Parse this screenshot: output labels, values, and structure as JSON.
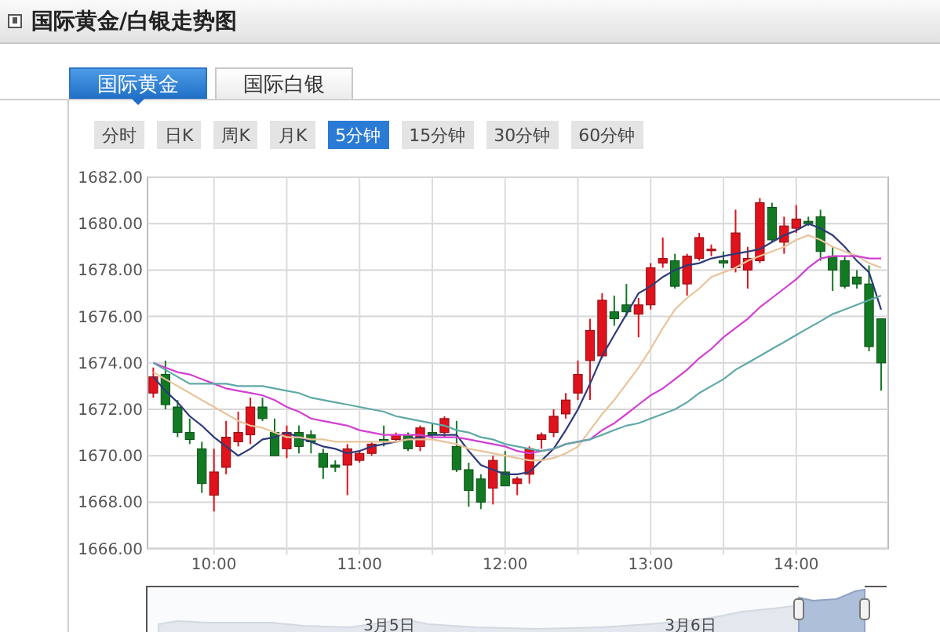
{
  "header": {
    "title": "国际黄金/白银走势图"
  },
  "tabs": [
    {
      "label": "国际黄金",
      "selected": true
    },
    {
      "label": "国际白银",
      "selected": false
    }
  ],
  "periods": [
    {
      "label": "分时",
      "selected": false
    },
    {
      "label": "日K",
      "selected": false
    },
    {
      "label": "周K",
      "selected": false
    },
    {
      "label": "月K",
      "selected": false
    },
    {
      "label": "5分钟",
      "selected": true
    },
    {
      "label": "15分钟",
      "selected": false
    },
    {
      "label": "30分钟",
      "selected": false
    },
    {
      "label": "60分钟",
      "selected": false
    }
  ],
  "chart": {
    "chart_data": {
      "type": "candlestick",
      "grid": true,
      "ylim": [
        1666,
        1682
      ],
      "yticks": [
        {
          "value": 1666,
          "label": "1666.00"
        },
        {
          "value": 1668,
          "label": "1668.00"
        },
        {
          "value": 1670,
          "label": "1670.00"
        },
        {
          "value": 1672,
          "label": "1672.00"
        },
        {
          "value": 1674,
          "label": "1674.00"
        },
        {
          "value": 1676,
          "label": "1676.00"
        },
        {
          "value": 1678,
          "label": "1678.00"
        },
        {
          "value": 1680,
          "label": "1680.00"
        },
        {
          "value": 1682,
          "label": "1682.00"
        }
      ],
      "categories": [
        null,
        null,
        null,
        null,
        null,
        "10:00",
        null,
        null,
        null,
        null,
        null,
        null,
        null,
        null,
        null,
        null,
        null,
        "11:00",
        null,
        null,
        null,
        null,
        null,
        null,
        null,
        null,
        null,
        null,
        null,
        "12:00",
        null,
        null,
        null,
        null,
        null,
        null,
        null,
        null,
        null,
        null,
        null,
        "13:00",
        null,
        null,
        null,
        null,
        null,
        null,
        null,
        null,
        null,
        null,
        null,
        "14:00",
        null,
        null,
        null,
        null,
        null,
        null,
        null
      ],
      "ohlc": [
        [
          1672.7,
          1673.8,
          1672.5,
          1673.4
        ],
        [
          1673.5,
          1674.1,
          1672.0,
          1672.2
        ],
        [
          1672.1,
          1672.4,
          1670.8,
          1671.0
        ],
        [
          1671.0,
          1671.6,
          1670.5,
          1670.7
        ],
        [
          1670.3,
          1670.6,
          1668.4,
          1668.8
        ],
        [
          1668.3,
          1670.3,
          1667.6,
          1669.3
        ],
        [
          1669.5,
          1671.5,
          1669.2,
          1670.8
        ],
        [
          1670.6,
          1671.9,
          1670.4,
          1671.0
        ],
        [
          1670.9,
          1672.5,
          1670.5,
          1672.1
        ],
        [
          1672.1,
          1672.5,
          1671.5,
          1671.6
        ],
        [
          1671.0,
          1671.6,
          1670.0,
          1670.0
        ],
        [
          1670.3,
          1671.3,
          1669.9,
          1671.0
        ],
        [
          1671.0,
          1671.3,
          1670.1,
          1670.4
        ],
        [
          1670.9,
          1671.1,
          1670.1,
          1670.6
        ],
        [
          1670.1,
          1670.3,
          1669.0,
          1669.5
        ],
        [
          1669.6,
          1669.8,
          1669.3,
          1669.5
        ],
        [
          1669.6,
          1670.5,
          1668.3,
          1670.3
        ],
        [
          1669.8,
          1670.2,
          1669.7,
          1670.1
        ],
        [
          1670.1,
          1670.6,
          1670.0,
          1670.5
        ],
        [
          1670.7,
          1671.3,
          1670.4,
          1670.6
        ],
        [
          1670.7,
          1671.0,
          1670.6,
          1670.9
        ],
        [
          1670.9,
          1671.0,
          1670.2,
          1670.3
        ],
        [
          1670.4,
          1671.3,
          1670.2,
          1671.2
        ],
        [
          1671.0,
          1671.4,
          1670.7,
          1670.9
        ],
        [
          1671.0,
          1671.7,
          1670.8,
          1671.6
        ],
        [
          1670.4,
          1671.5,
          1669.3,
          1669.4
        ],
        [
          1669.4,
          1669.7,
          1667.8,
          1668.5
        ],
        [
          1669.0,
          1669.2,
          1667.7,
          1668.0
        ],
        [
          1668.6,
          1670.0,
          1667.9,
          1669.8
        ],
        [
          1669.3,
          1670.2,
          1668.7,
          1668.7
        ],
        [
          1668.8,
          1669.1,
          1668.3,
          1669.0
        ],
        [
          1669.2,
          1670.4,
          1668.8,
          1670.3
        ],
        [
          1670.7,
          1671.0,
          1670.3,
          1670.9
        ],
        [
          1671.0,
          1672.0,
          1670.8,
          1671.7
        ],
        [
          1671.8,
          1672.7,
          1671.6,
          1672.4
        ],
        [
          1672.7,
          1674.1,
          1672.4,
          1673.5
        ],
        [
          1674.1,
          1675.9,
          1672.4,
          1675.4
        ],
        [
          1674.3,
          1677.0,
          1674.2,
          1676.7
        ],
        [
          1676.2,
          1676.9,
          1675.6,
          1675.9
        ],
        [
          1676.5,
          1677.4,
          1676.0,
          1676.2
        ],
        [
          1676.1,
          1676.8,
          1675.1,
          1676.5
        ],
        [
          1676.5,
          1678.3,
          1676.3,
          1678.1
        ],
        [
          1678.3,
          1679.4,
          1678.1,
          1678.5
        ],
        [
          1678.4,
          1678.7,
          1677.2,
          1677.3
        ],
        [
          1677.4,
          1678.7,
          1676.9,
          1678.6
        ],
        [
          1678.5,
          1679.6,
          1678.4,
          1679.4
        ],
        [
          1678.9,
          1679.1,
          1678.6,
          1678.9
        ],
        [
          1678.4,
          1678.8,
          1678.1,
          1678.3
        ],
        [
          1678.1,
          1680.6,
          1677.9,
          1679.6
        ],
        [
          1678.0,
          1679.0,
          1677.2,
          1678.5
        ],
        [
          1678.4,
          1681.1,
          1678.3,
          1680.9
        ],
        [
          1680.7,
          1680.9,
          1679.2,
          1679.3
        ],
        [
          1679.2,
          1680.3,
          1678.7,
          1679.9
        ],
        [
          1679.8,
          1680.8,
          1679.6,
          1680.2
        ],
        [
          1680.1,
          1680.3,
          1679.9,
          1680.0
        ],
        [
          1680.3,
          1680.6,
          1678.4,
          1678.8
        ],
        [
          1678.6,
          1679.0,
          1677.1,
          1678.0
        ],
        [
          1678.4,
          1678.6,
          1677.2,
          1677.3
        ],
        [
          1677.7,
          1678.0,
          1677.2,
          1677.4
        ],
        [
          1677.4,
          1678.2,
          1674.5,
          1674.7
        ],
        [
          1675.9,
          1675.9,
          1672.8,
          1674.0
        ]
      ],
      "series": [
        {
          "type": "line",
          "color": "#2f3a78",
          "values": [
            1673.4,
            1672.8,
            1672.3,
            1671.7,
            1671.3,
            1670.8,
            1670.4,
            1670.0,
            1670.3,
            1670.7,
            1670.8,
            1671.0,
            1670.8,
            1670.6,
            1670.4,
            1670.3,
            1670.1,
            1670.2,
            1670.4,
            1670.5,
            1670.6,
            1670.7,
            1670.8,
            1670.9,
            1670.9,
            1670.9,
            1670.2,
            1669.6,
            1669.4,
            1669.2,
            1669.2,
            1669.3,
            1669.8,
            1670.3,
            1671.1,
            1672.0,
            1673.1,
            1674.3,
            1675.2,
            1676.1,
            1677.0,
            1677.3,
            1677.7,
            1678.0,
            1678.2,
            1678.3,
            1678.5,
            1678.6,
            1678.7,
            1678.8,
            1678.9,
            1679.2,
            1679.5,
            1679.7,
            1680.0,
            1679.8,
            1679.5,
            1679.0,
            1678.4,
            1677.9,
            1676.3
          ]
        },
        {
          "type": "line",
          "color": "#e8c49c",
          "values": [
            1673.6,
            1673.3,
            1673.0,
            1672.7,
            1672.4,
            1672.1,
            1671.8,
            1671.5,
            1671.3,
            1671.2,
            1671.0,
            1670.8,
            1670.8,
            1670.7,
            1670.7,
            1670.6,
            1670.6,
            1670.6,
            1670.6,
            1670.6,
            1670.6,
            1670.7,
            1670.7,
            1670.7,
            1670.6,
            1670.5,
            1670.3,
            1670.2,
            1670.1,
            1670.0,
            1669.9,
            1669.8,
            1669.8,
            1669.9,
            1670.1,
            1670.4,
            1671.1,
            1671.8,
            1672.4,
            1673.1,
            1673.8,
            1674.6,
            1675.5,
            1676.3,
            1676.8,
            1677.2,
            1677.7,
            1677.9,
            1678.1,
            1678.4,
            1678.6,
            1678.8,
            1679.0,
            1679.3,
            1679.5,
            1679.3,
            1679.0,
            1678.8,
            1678.6,
            1678.3,
            1678.1
          ]
        },
        {
          "type": "line",
          "color": "#d23fd2",
          "values": [
            1674.0,
            1673.8,
            1673.6,
            1673.5,
            1673.3,
            1673.1,
            1672.9,
            1672.8,
            1672.7,
            1672.6,
            1672.4,
            1672.1,
            1671.9,
            1671.6,
            1671.5,
            1671.4,
            1671.3,
            1671.1,
            1671.0,
            1670.9,
            1670.9,
            1670.9,
            1670.9,
            1670.8,
            1670.8,
            1670.8,
            1670.7,
            1670.6,
            1670.5,
            1670.4,
            1670.2,
            1670.1,
            1670.2,
            1670.3,
            1670.5,
            1670.6,
            1670.7,
            1671.1,
            1671.4,
            1671.8,
            1672.2,
            1672.6,
            1672.9,
            1673.3,
            1673.7,
            1674.2,
            1674.6,
            1675.1,
            1675.5,
            1675.9,
            1676.4,
            1676.8,
            1677.2,
            1677.6,
            1678.1,
            1678.5,
            1678.6,
            1678.6,
            1678.6,
            1678.5,
            1678.5
          ]
        },
        {
          "type": "line",
          "color": "#5fa9a6",
          "values": [
            1674.0,
            1673.7,
            1673.4,
            1673.1,
            1673.1,
            1673.1,
            1673.1,
            1673.0,
            1673.0,
            1673.0,
            1672.9,
            1672.8,
            1672.7,
            1672.5,
            1672.4,
            1672.3,
            1672.2,
            1672.1,
            1672.0,
            1671.9,
            1671.7,
            1671.6,
            1671.5,
            1671.4,
            1671.3,
            1671.1,
            1671.0,
            1670.8,
            1670.7,
            1670.5,
            1670.4,
            1670.3,
            1670.2,
            1670.3,
            1670.5,
            1670.6,
            1670.7,
            1670.9,
            1671.1,
            1671.3,
            1671.4,
            1671.6,
            1671.8,
            1672.0,
            1672.3,
            1672.7,
            1673.0,
            1673.3,
            1673.7,
            1674.0,
            1674.3,
            1674.6,
            1674.9,
            1675.2,
            1675.5,
            1675.8,
            1676.1,
            1676.3,
            1676.5,
            1676.7,
            1676.9
          ]
        }
      ]
    }
  },
  "navigator": {
    "date_labels": [
      "3月5日",
      "3月6日"
    ]
  }
}
